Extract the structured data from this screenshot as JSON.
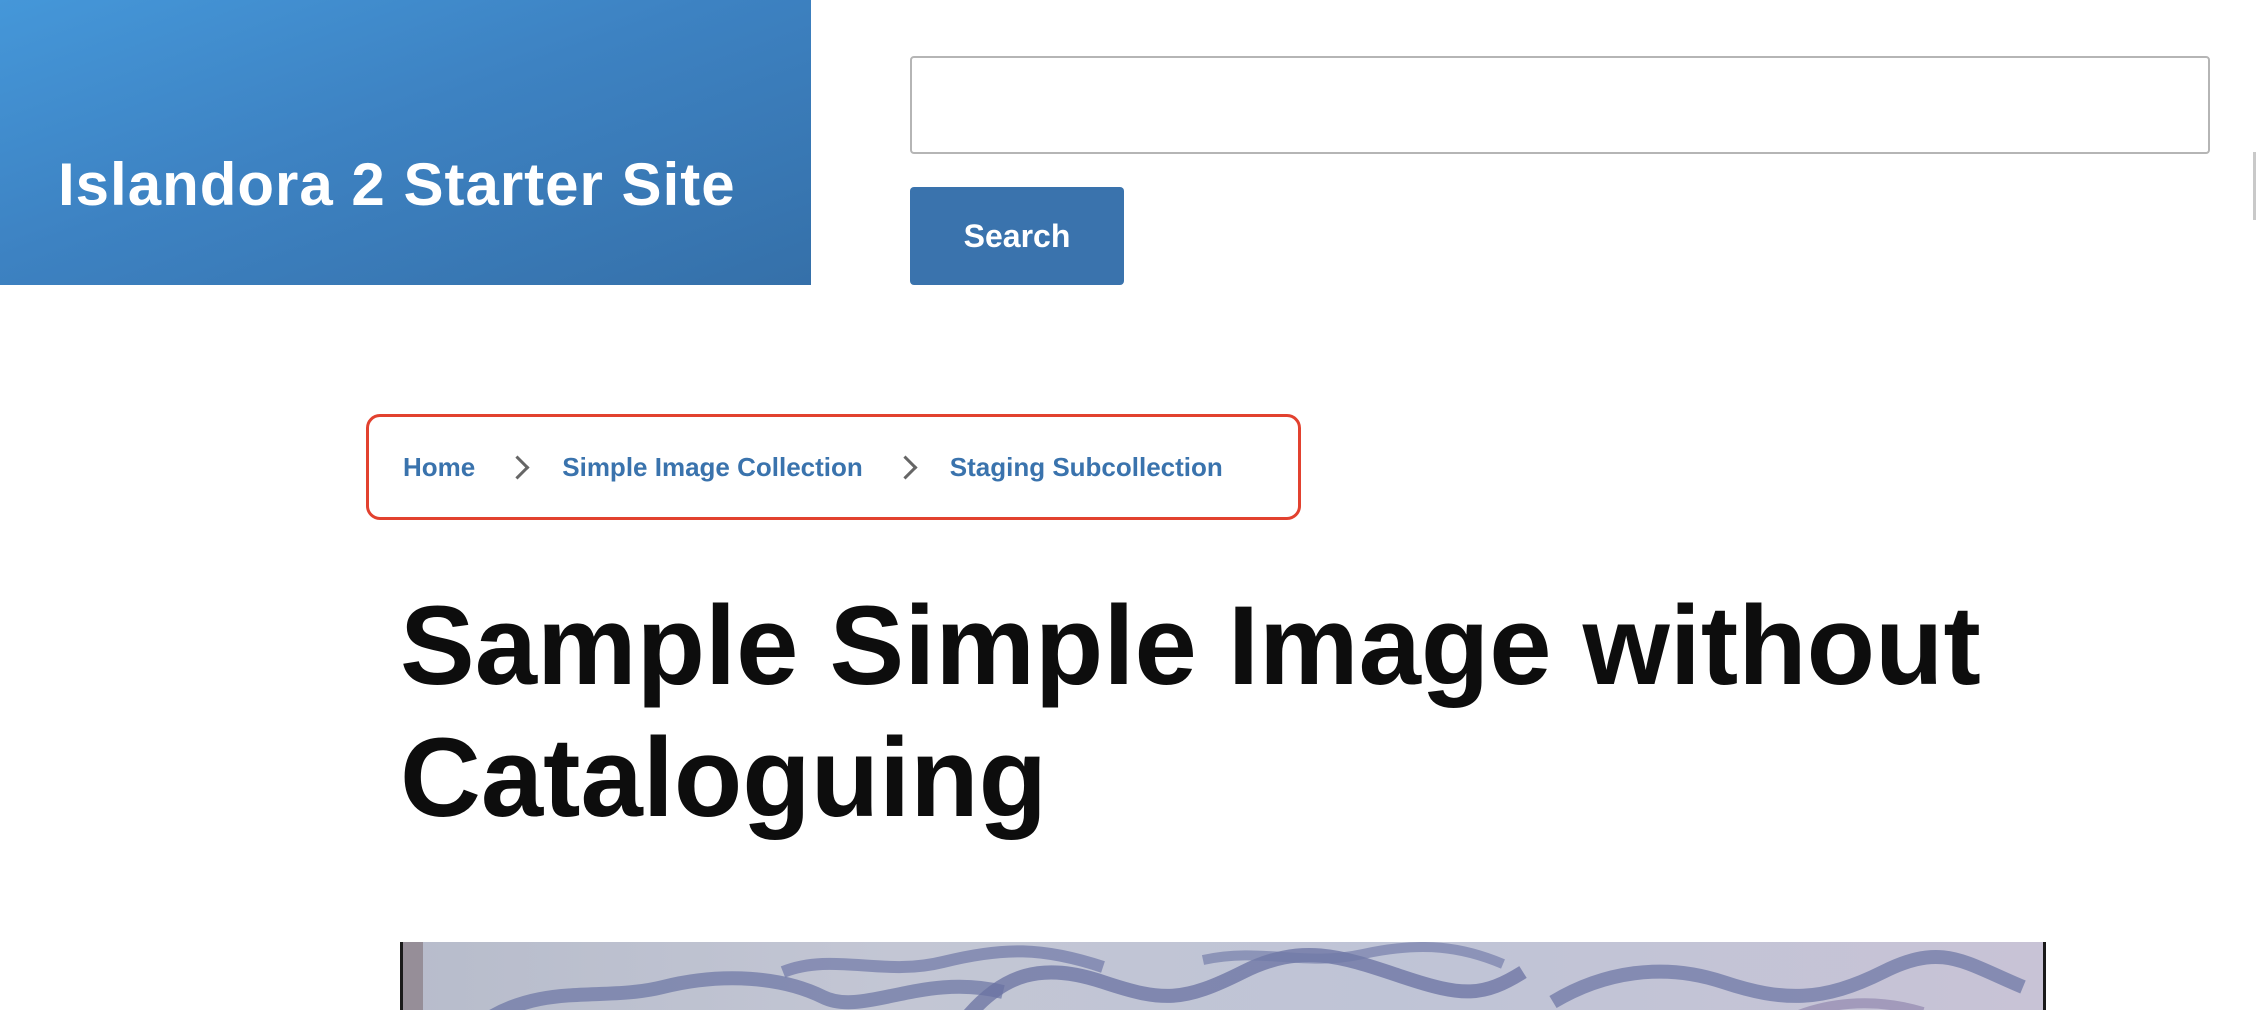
{
  "header": {
    "site_name": "Islandora 2 Starter Site"
  },
  "search": {
    "input_value": "",
    "button_label": "Search"
  },
  "breadcrumb": {
    "items": [
      {
        "label": "Home"
      },
      {
        "label": "Simple Image Collection"
      },
      {
        "label": "Staging Subcollection"
      }
    ]
  },
  "main": {
    "title": "Sample Simple Image without Cataloguing"
  },
  "colors": {
    "brand_blue": "#3a73ad",
    "header_gradient_start": "#4597d9",
    "header_gradient_end": "#3570a9",
    "highlight_border": "#e2412f",
    "title_text": "#0d0d0d"
  },
  "icons": {
    "breadcrumb_separator": "chevron-right-icon"
  }
}
